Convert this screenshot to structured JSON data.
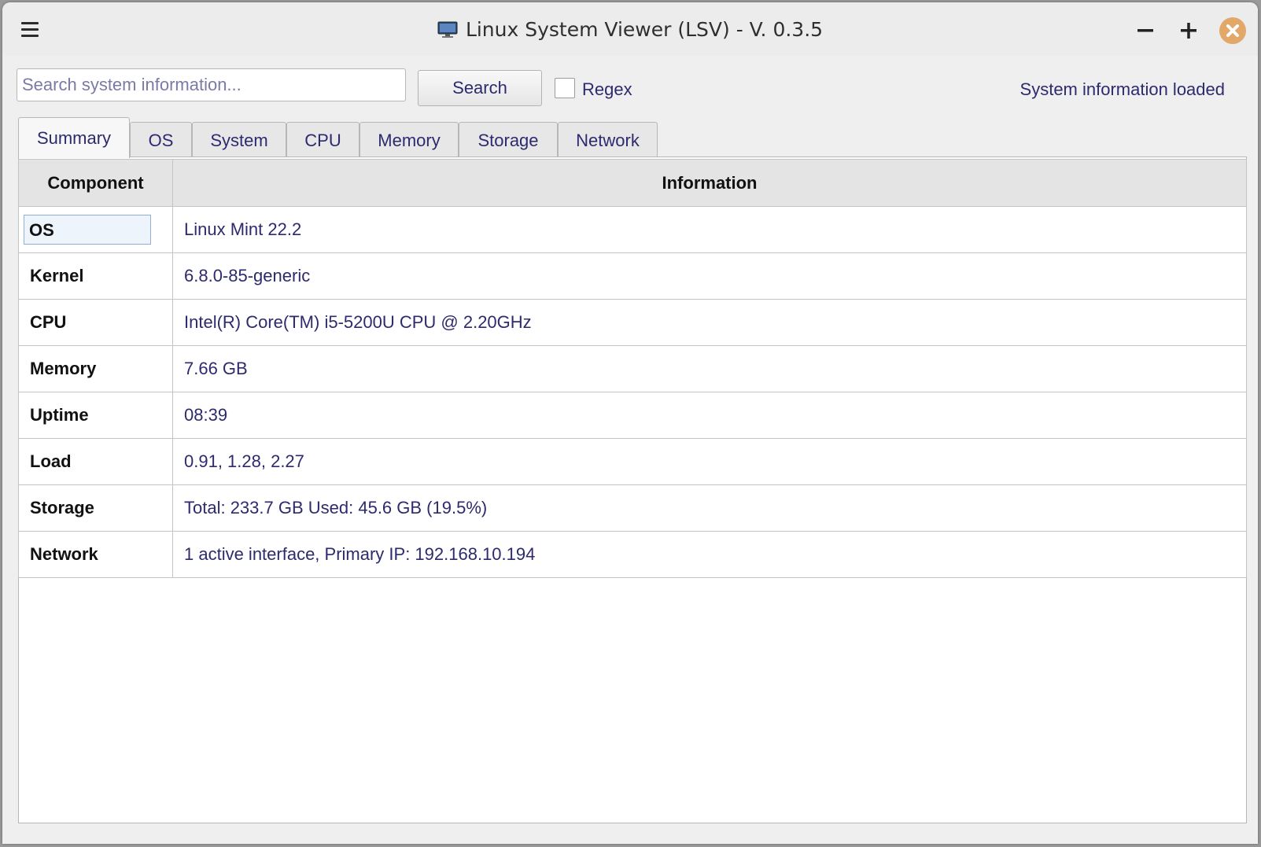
{
  "window": {
    "title": "Linux System Viewer (LSV) - V. 0.3.5",
    "app_icon": "monitor-icon",
    "controls": [
      "minimize-icon",
      "maximize-icon",
      "close-icon"
    ],
    "close_button_color": "#e3a76a"
  },
  "search": {
    "placeholder": "Search system information...",
    "value": "",
    "button_label": "Search",
    "regex_label": "Regex",
    "regex_checked": false
  },
  "status": "System information loaded",
  "tabs": [
    {
      "label": "Summary",
      "active": true
    },
    {
      "label": "OS",
      "active": false
    },
    {
      "label": "System",
      "active": false
    },
    {
      "label": "CPU",
      "active": false
    },
    {
      "label": "Memory",
      "active": false
    },
    {
      "label": "Storage",
      "active": false
    },
    {
      "label": "Network",
      "active": false
    }
  ],
  "table": {
    "headers": [
      "Component",
      "Information"
    ],
    "rows": [
      {
        "component": "OS",
        "information": "Linux Mint 22.2",
        "selected": true
      },
      {
        "component": "Kernel",
        "information": "6.8.0-85-generic"
      },
      {
        "component": "CPU",
        "information": "Intel(R) Core(TM) i5-5200U CPU @ 2.20GHz"
      },
      {
        "component": "Memory",
        "information": "7.66 GB"
      },
      {
        "component": "Uptime",
        "information": "08:39"
      },
      {
        "component": "Load",
        "information": "0.91, 1.28, 2.27"
      },
      {
        "component": "Storage",
        "information": "Total: 233.7 GB Used: 45.6 GB (19.5%)"
      },
      {
        "component": "Network",
        "information": "1 active interface, Primary IP: 192.168.10.194"
      }
    ]
  },
  "colors": {
    "text_accent": "#2d2a6e",
    "header_bg": "#e4e4e4"
  }
}
